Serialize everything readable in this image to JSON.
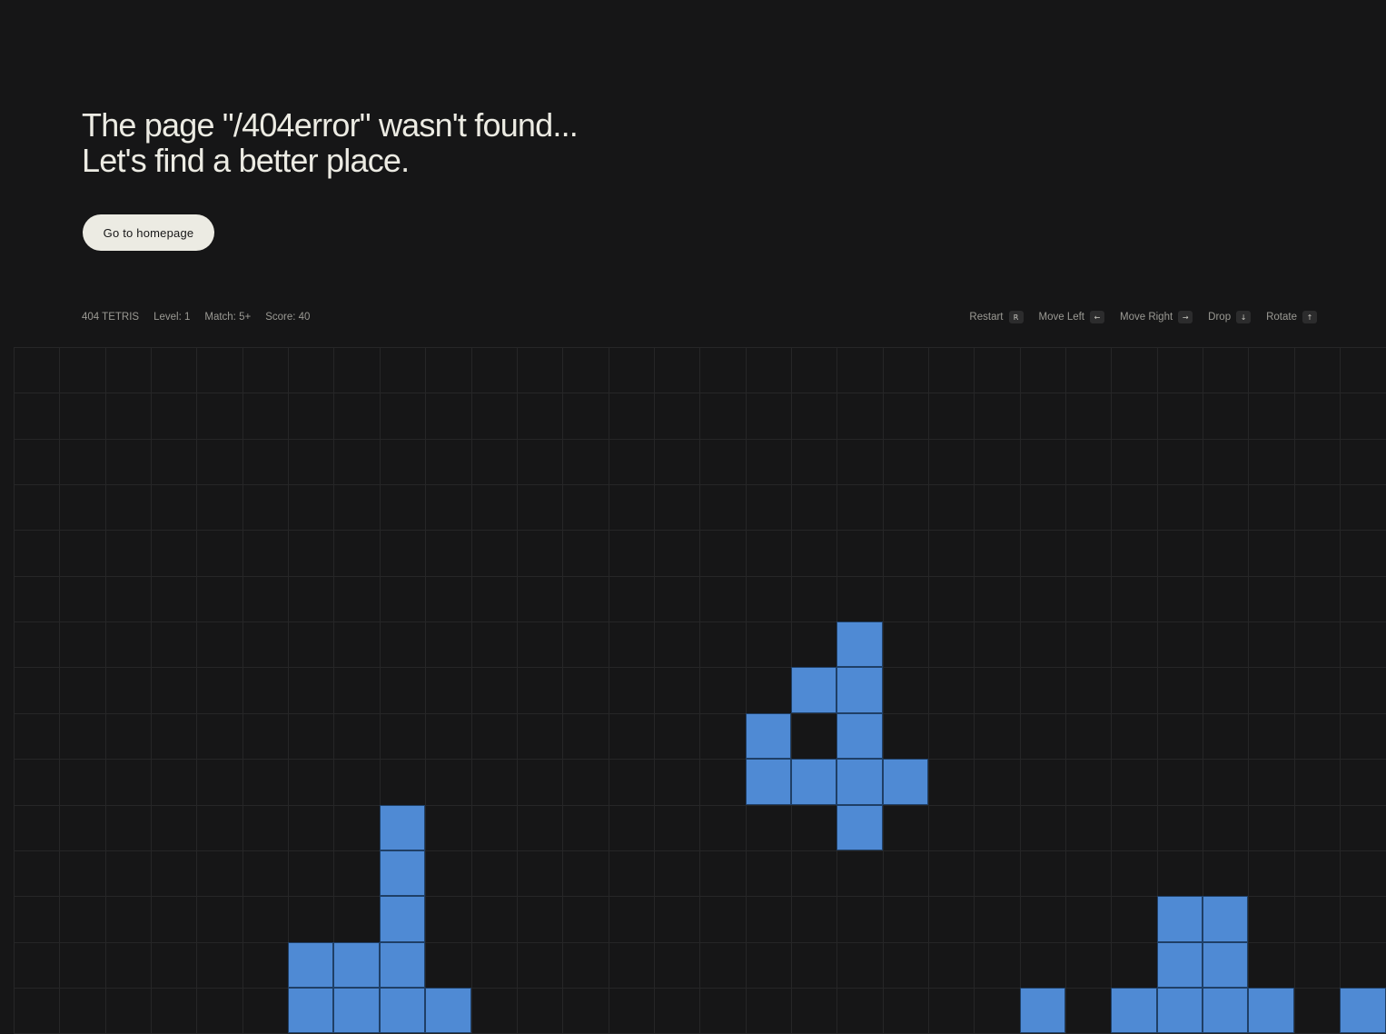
{
  "headline": {
    "line1": "The page \"/404error\" wasn't found...",
    "line2": "Let's find a better place."
  },
  "homepage_button": "Go to homepage",
  "status": {
    "game_name": "404 TETRIS",
    "level": "Level: 1",
    "match": "Match: 5+",
    "score": "Score: 40"
  },
  "controls": [
    {
      "label": "Restart",
      "key": "R",
      "icon": "r-key"
    },
    {
      "label": "Move Left",
      "key": "←",
      "icon": "arrow-left-key"
    },
    {
      "label": "Move Right",
      "key": "→",
      "icon": "arrow-right-key"
    },
    {
      "label": "Drop",
      "key": "↓",
      "icon": "arrow-down-key"
    },
    {
      "label": "Rotate",
      "key": "↑",
      "icon": "arrow-up-key"
    }
  ],
  "board": {
    "columns": 30,
    "rows": 15,
    "background": "#161617",
    "grid_color": "#262627",
    "block_color": "#4f8ad4",
    "block_border": "#1f3f66",
    "filled_cells": [
      [
        6,
        18
      ],
      [
        7,
        17
      ],
      [
        7,
        18
      ],
      [
        8,
        16
      ],
      [
        8,
        18
      ],
      [
        9,
        16
      ],
      [
        9,
        17
      ],
      [
        9,
        18
      ],
      [
        9,
        19
      ],
      [
        10,
        8
      ],
      [
        10,
        18
      ],
      [
        11,
        8
      ],
      [
        12,
        8
      ],
      [
        12,
        25
      ],
      [
        12,
        26
      ],
      [
        13,
        6
      ],
      [
        13,
        7
      ],
      [
        13,
        8
      ],
      [
        13,
        25
      ],
      [
        13,
        26
      ],
      [
        14,
        6
      ],
      [
        14,
        7
      ],
      [
        14,
        8
      ],
      [
        14,
        9
      ],
      [
        14,
        22
      ],
      [
        14,
        24
      ],
      [
        14,
        25
      ],
      [
        14,
        26
      ],
      [
        14,
        27
      ],
      [
        14,
        29
      ]
    ]
  }
}
